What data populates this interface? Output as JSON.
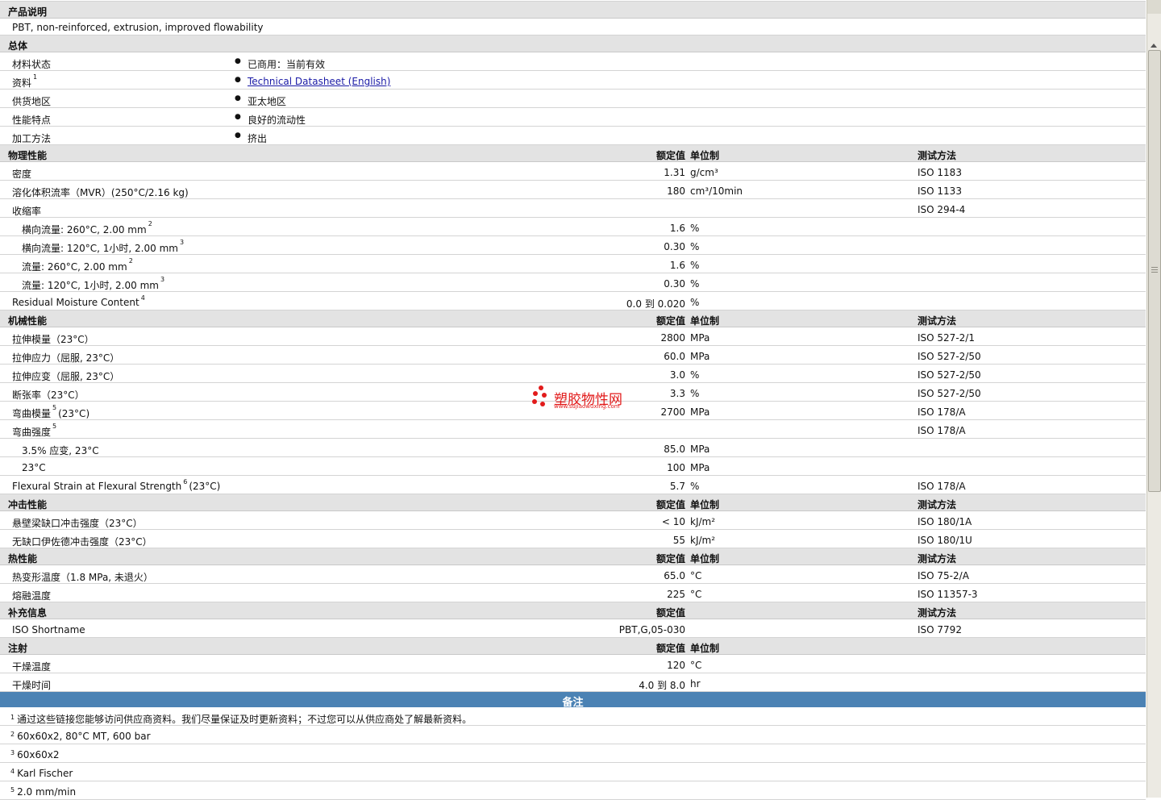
{
  "sections": {
    "description": {
      "title": "产品说明",
      "text": "PBT, non-reinforced, extrusion, improved flowability"
    },
    "general": {
      "title": "总体",
      "rows": [
        {
          "label": "材料状态",
          "value": "已商用：当前有效"
        },
        {
          "label": "资料",
          "sup": "1",
          "value": "Technical Datasheet (English)",
          "link": true
        },
        {
          "label": "供货地区",
          "value": "亚太地区"
        },
        {
          "label": "性能特点",
          "value": "良好的流动性"
        },
        {
          "label": "加工方法",
          "value": "挤出"
        }
      ]
    },
    "physical": {
      "title": "物理性能",
      "col_value": "额定值",
      "col_unit": "单位制",
      "col_test": "测试方法",
      "rows": [
        {
          "label": "密度",
          "value": "1.31",
          "unit": "g/cm³",
          "test": "ISO 1183"
        },
        {
          "label": "溶化体积流率（MVR）(250°C/2.16 kg)",
          "value": "180",
          "unit": "cm³/10min",
          "test": "ISO 1133"
        },
        {
          "label": "收缩率",
          "value": "",
          "unit": "",
          "test": "ISO 294-4"
        },
        {
          "label": "横向流量: 260°C, 2.00 mm",
          "sup": "2",
          "indent": true,
          "value": "1.6",
          "unit": "%",
          "test": ""
        },
        {
          "label": "横向流量: 120°C, 1小时, 2.00 mm",
          "sup": "3",
          "indent": true,
          "value": "0.30",
          "unit": "%",
          "test": ""
        },
        {
          "label": "流量: 260°C, 2.00 mm",
          "sup": "2",
          "indent": true,
          "value": "1.6",
          "unit": "%",
          "test": ""
        },
        {
          "label": "流量: 120°C, 1小时, 2.00 mm",
          "sup": "3",
          "indent": true,
          "value": "0.30",
          "unit": "%",
          "test": ""
        },
        {
          "label": "Residual Moisture Content",
          "sup": "4",
          "value": "0.0 到  0.020",
          "unit": "%",
          "test": ""
        }
      ]
    },
    "mechanical": {
      "title": "机械性能",
      "col_value": "额定值",
      "col_unit": "单位制",
      "col_test": "测试方法",
      "rows": [
        {
          "label": "拉伸模量（23°C）",
          "value": "2800",
          "unit": "MPa",
          "test": "ISO 527-2/1"
        },
        {
          "label": "拉伸应力（屈服, 23°C）",
          "value": "60.0",
          "unit": "MPa",
          "test": "ISO 527-2/50"
        },
        {
          "label": "拉伸应变（屈服, 23°C）",
          "value": "3.0",
          "unit": "%",
          "test": "ISO 527-2/50"
        },
        {
          "label": "断张率（23°C）",
          "value": "3.3",
          "unit": "%",
          "test": "ISO 527-2/50"
        },
        {
          "label": "弯曲模量",
          "sup": "5",
          "suffix": "(23°C)",
          "value": "2700",
          "unit": "MPa",
          "test": "ISO 178/A"
        },
        {
          "label": "弯曲强度",
          "sup": "5",
          "value": "",
          "unit": "",
          "test": "ISO 178/A"
        },
        {
          "label": "3.5% 应变, 23°C",
          "indent": true,
          "value": "85.0",
          "unit": "MPa",
          "test": ""
        },
        {
          "label": "23°C",
          "indent": true,
          "value": "100",
          "unit": "MPa",
          "test": ""
        },
        {
          "label": "Flexural Strain at Flexural Strength",
          "sup": "6",
          "suffix": "(23°C)",
          "value": "5.7",
          "unit": "%",
          "test": "ISO 178/A"
        }
      ]
    },
    "impact": {
      "title": "冲击性能",
      "col_value": "额定值",
      "col_unit": "单位制",
      "col_test": "测试方法",
      "rows": [
        {
          "label": "悬壁梁缺口冲击强度（23°C）",
          "value": "< 10",
          "unit": "kJ/m²",
          "test": "ISO 180/1A"
        },
        {
          "label": "无缺口伊佐德冲击强度（23°C）",
          "value": "55",
          "unit": "kJ/m²",
          "test": "ISO 180/1U"
        }
      ]
    },
    "thermal": {
      "title": "热性能",
      "col_value": "额定值",
      "col_unit": "单位制",
      "col_test": "测试方法",
      "rows": [
        {
          "label": "热变形温度（1.8 MPa, 未退火）",
          "value": "65.0",
          "unit": "°C",
          "test": "ISO 75-2/A"
        },
        {
          "label": "熔融温度",
          "value": "225",
          "unit": "°C",
          "test": "ISO 11357-3"
        }
      ]
    },
    "supplemental": {
      "title": "补充信息",
      "col_value": "额定值",
      "col_unit": "",
      "col_test": "测试方法",
      "rows": [
        {
          "label": "ISO Shortname",
          "value": "PBT,G,05-030",
          "unit": "",
          "test": "ISO 7792"
        }
      ]
    },
    "injection": {
      "title": "注射",
      "col_value": "额定值",
      "col_unit": "单位制",
      "col_test": "",
      "rows": [
        {
          "label": "干燥温度",
          "value": "120",
          "unit": "°C",
          "test": ""
        },
        {
          "label": "干燥时间",
          "value": "4.0 到  8.0",
          "unit": "hr",
          "test": ""
        }
      ]
    }
  },
  "notes": {
    "title": "备注",
    "items": [
      {
        "num": "1",
        "text": "通过这些链接您能够访问供应商资料。我们尽量保证及时更新资料；不过您可以从供应商处了解最新资料。"
      },
      {
        "num": "2",
        "text": "60x60x2, 80°C MT, 600 bar"
      },
      {
        "num": "3",
        "text": "60x60x2"
      },
      {
        "num": "4",
        "text": "Karl Fischer"
      },
      {
        "num": "5",
        "text": "2.0 mm/min"
      }
    ]
  },
  "watermark": {
    "brand": "塑胶物性网",
    "site": "www.sujiaowuxing.com"
  }
}
